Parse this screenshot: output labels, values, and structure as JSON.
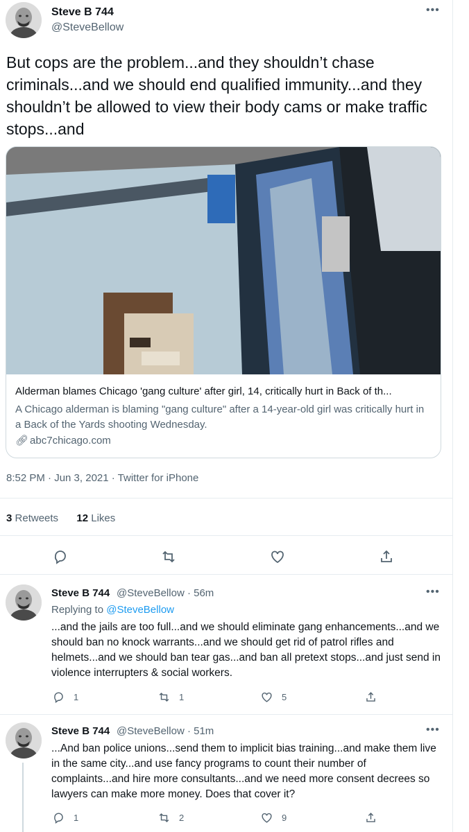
{
  "tweet": {
    "display_name": "Steve B 744",
    "handle": "@SteveBellow",
    "more": "•••",
    "text": "But cops are the problem...and they shouldn’t chase criminals...and we should end qualified immunity...and they shouldn’t be allowed to view their body cams or make traffic stops...and",
    "card": {
      "title": "Alderman blames Chicago 'gang culture' after girl, 14, critically hurt in Back of th...",
      "description": "A Chicago alderman is blaming \"gang culture\" after a 14-year-old girl was critically hurt in a Back of the Yards shooting Wednesday.",
      "link": "abc7chicago.com"
    },
    "meta": "8:52 PM · Jun 3, 2021 · Twitter for iPhone",
    "retweets_count": "3",
    "retweets_label": "Retweets",
    "likes_count": "12",
    "likes_label": "Likes",
    "actions": [
      "reply-icon",
      "retweet-icon",
      "like-icon",
      "share-icon"
    ]
  },
  "replies": [
    {
      "display_name": "Steve B 744",
      "handle_time": "@SteveBellow · 56m",
      "replying_prefix": "Replying to",
      "replying_handle": "@SteveBellow",
      "text": "...and the jails are too full...and we should eliminate gang enhancements...and we should ban no knock warrants...and we should get rid of patrol rifles and helmets...and we should ban tear gas...and ban all pretext stops...and just send in violence interrupters & social workers.",
      "reply_count": "1",
      "retweet_count": "1",
      "like_count": "5"
    },
    {
      "display_name": "Steve B 744",
      "handle_time": "@SteveBellow · 51m",
      "text": "...And ban police unions...send them to implicit bias training...and make them live in the same city...and use fancy programs to count their number of complaints...and hire more consultants...and we need more consent decrees so lawyers can make more money. Does that cover it?",
      "reply_count": "1",
      "retweet_count": "2",
      "like_count": "9"
    }
  ],
  "colors": {
    "text": "#0f1419",
    "secondary": "#536471",
    "link": "#1d9bf0",
    "border": "#cfd9de"
  }
}
